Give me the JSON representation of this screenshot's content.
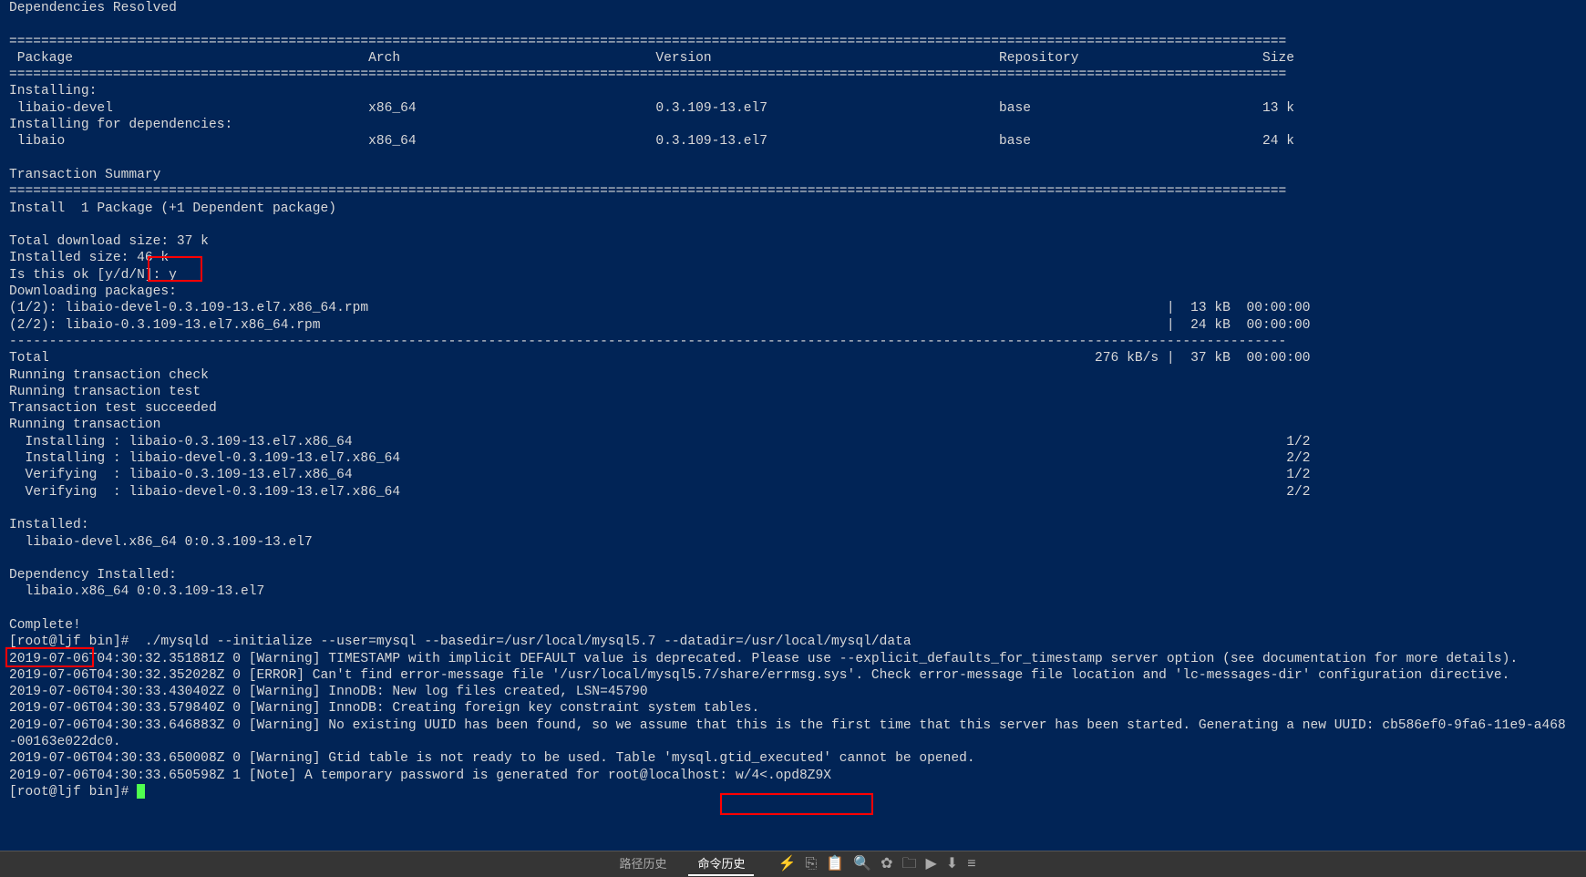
{
  "title": "Dependencies Resolved",
  "sep_eq": "================================================================================================================================================================",
  "sep_dash": "----------------------------------------------------------------------------------------------------------------------------------------------------------------",
  "thead": {
    "package": "Package",
    "arch": "Arch",
    "version": "Version",
    "repo": "Repository",
    "size": "Size"
  },
  "install_header": "Installing:",
  "row1": {
    "name": " libaio-devel",
    "arch": "x86_64",
    "version": "0.3.109-13.el7",
    "repo": "base",
    "size": "13 k"
  },
  "install_dep_header": "Installing for dependencies:",
  "row2": {
    "name": " libaio",
    "arch": "x86_64",
    "version": "0.3.109-13.el7",
    "repo": "base",
    "size": "24 k"
  },
  "txn_summary": "Transaction Summary",
  "install_count": "Install  1 Package (+1 Dependent package)",
  "dl_size": "Total download size: 37 k",
  "inst_size": "Installed size: 46 k",
  "prompt": "Is this ok [y/d/N]",
  "answer": ": y",
  "dl_pkgs": "Downloading packages:",
  "dl1": "(1/2): libaio-devel-0.3.109-13.el7.x86_64.rpm",
  "dl1t": "|  13 kB  00:00:00",
  "dl2": "(2/2): libaio-0.3.109-13.el7.x86_64.rpm",
  "dl2t": "|  24 kB  00:00:00",
  "total": "Total",
  "total_rate": "276 kB/s |  37 kB  00:00:00",
  "r1": "Running transaction check",
  "r2": "Running transaction test",
  "r3": "Transaction test succeeded",
  "r4": "Running transaction",
  "i1": "  Installing : libaio-0.3.109-13.el7.x86_64",
  "i1p": "1/2",
  "i2": "  Installing : libaio-devel-0.3.109-13.el7.x86_64",
  "i2p": "2/2",
  "v1": "  Verifying  : libaio-0.3.109-13.el7.x86_64",
  "v1p": "1/2",
  "v2": "  Verifying  : libaio-devel-0.3.109-13.el7.x86_64",
  "v2p": "2/2",
  "installed_hdr": "Installed:",
  "installed_line": "  libaio-devel.x86_64 0:0.3.109-13.el7",
  "dep_installed_hdr": "Dependency Installed:",
  "dep_installed_line": "  libaio.x86_64 0:0.3.109-13.el7",
  "complete": "Complete!",
  "init_cmd": "[root@ljf bin]#  ./mysqld --initialize --user=mysql --basedir=/usr/local/mysql5.7 --datadir=/usr/local/mysql/data",
  "log1": "2019-07-06T04:30:32.351881Z 0 [Warning] TIMESTAMP with implicit DEFAULT value is deprecated. Please use --explicit_defaults_for_timestamp server option (see documentation for more details).",
  "log2": "2019-07-06T04:30:32.352028Z 0 [ERROR] Can't find error-message file '/usr/local/mysql5.7/share/errmsg.sys'. Check error-message file location and 'lc-messages-dir' configuration directive.",
  "log3": "2019-07-06T04:30:33.430402Z 0 [Warning] InnoDB: New log files created, LSN=45790",
  "log4": "2019-07-06T04:30:33.579840Z 0 [Warning] InnoDB: Creating foreign key constraint system tables.",
  "log5": "2019-07-06T04:30:33.646883Z 0 [Warning] No existing UUID has been found, so we assume that this is the first time that this server has been started. Generating a new UUID: cb586ef0-9fa6-11e9-a468",
  "log5b": "-00163e022dc0.",
  "log6": "2019-07-06T04:30:33.650008Z 0 [Warning] Gtid table is not ready to be used. Table 'mysql.gtid_executed' cannot be opened.",
  "log7a": "2019-07-06T04:30:33.650598Z 1 [Note] A temporary password is generated for root@localhost",
  "log7b": ": w/4<.opd8Z9X",
  "prompt2": "[root@ljf bin]# ",
  "bottom": {
    "tab1": "路径历史",
    "tab2": "命令历史"
  }
}
